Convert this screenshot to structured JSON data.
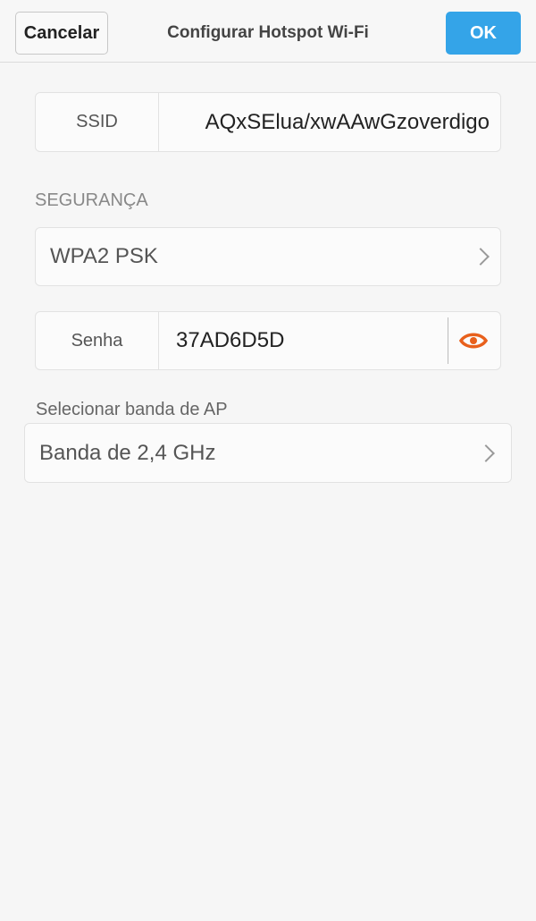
{
  "header": {
    "cancel_label": "Cancelar",
    "title": "Configurar Hotspot Wi-Fi",
    "ok_label": "OK"
  },
  "ssid": {
    "label": "SSID",
    "value": "AQxSElua/xwAAwGzoverdigo"
  },
  "security": {
    "section_label": "SEGURANÇA",
    "selected": "WPA2 PSK"
  },
  "password": {
    "label": "Senha",
    "value": "37AD6D5D",
    "visibility_icon": "eye-icon"
  },
  "band": {
    "section_label": "Selecionar banda de AP",
    "selected": "Banda de 2,4 GHz"
  },
  "colors": {
    "ok_button": "#34a4e8",
    "eye_icon": "#e8601c"
  }
}
